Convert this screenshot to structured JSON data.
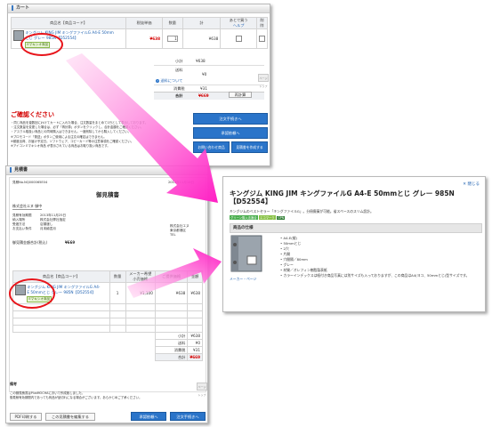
{
  "cart": {
    "title": "カート",
    "headers": {
      "product": "商品名【商品コード】",
      "unit_price": "税抜単価",
      "qty": "数量",
      "total": "計",
      "wish": "あとで買う",
      "delete": "削除"
    },
    "wish_sub": "ヘルプ",
    "item": {
      "name": "キングジム KING JIM キングファイルG A4-E 50mmとじ グレー 985N【D52554】",
      "badge": "Eマキシオ商品",
      "price": "¥638",
      "qty": "1",
      "total": "¥638"
    },
    "subtotal_label": "小計",
    "subtotal": "¥638",
    "shipping_label": "送料",
    "shipping": "¥0",
    "shipping_note": "送料について",
    "tax_label": "消費税",
    "tax": "¥31",
    "grand_label": "合計",
    "grand": "¥669",
    "recalc": "再計算",
    "tab": "ページトップ",
    "confirm_title": "ご確認ください",
    "confirm_lines": [
      "・同じ商品を複数回にわけてカートに入れた場合、注文数量をまとめて1行として表示しております。",
      "・注文数量を変更した場合は、必ず「再計算」ボタンをクリックし、合計金額をご確認ください。",
      "・アスクル取扱い商品との同時購入はできません。一度削除してから購入してください。",
      "※プロモコード「発送」ボタンご使用による注文の確定はできません。",
      "※都度出荷、お届け予定日。ソフトウェア、コピーカード等の注意事項をご確認ください。",
      "※アイコン  Eマキシオ商品 が表示されている商品はお取り扱い商品です。"
    ],
    "checkout_btn": "注文手続きへ",
    "quote_btn": "承認依頼へ",
    "compare_btn": "お問い合わせ商品",
    "print_btn": "見積書を作成する"
  },
  "quote": {
    "title": "見積書",
    "doc_no": "見積No.NQ000065E04",
    "date": "2013年11月18日",
    "heading": "御見積書",
    "company": "株式会社エヌ 御中",
    "info_labels": [
      "見積有効期限",
      "納入場所",
      "受渡方法",
      "お支払い条件"
    ],
    "info_values": [
      "2013年11月25日",
      "株式会社弊社指定",
      "店頭渡し",
      "月末締翌月"
    ],
    "right_company": "株式会社エヌ",
    "right_addr": "東京都港区",
    "right_tel": "TEL",
    "amount_label": "御見積金額合計(税込)",
    "amount": "¥669",
    "headers": {
      "product": "商品名【商品コード】",
      "qty": "数量",
      "list": "メーカー希望小売価格",
      "price": "ご提供価格",
      "amount": "金額"
    },
    "item": {
      "name": "キングジム KING JIM キングファイルG A4-E 50mmとじ グレー 985N【D52554】",
      "badge": "Eマキシオ商品",
      "qty": "1",
      "list": "¥1,100",
      "price": "¥638",
      "amount": "¥638"
    },
    "subtotal_label": "小計",
    "subtotal": "¥638",
    "shipping_label": "送料",
    "shipping": "¥0",
    "tax_label": "消費税",
    "tax": "¥31",
    "grand_label": "合計",
    "grand": "¥669",
    "note_title": "備考",
    "note_lines": [
      "この御見積書はPlusMOCHAにおいて作成致しました。",
      "御見積有効期間内であっても商品が品切れになる場合がございます。あらかじめご了承ください。"
    ],
    "tab": "ページトップ",
    "pdf_btn": "PDF印刷する",
    "edit_btn": "この見積書を編集する",
    "approve_btn": "承認依頼へ",
    "order_btn": "注文手続きへ"
  },
  "detail": {
    "close": "閉じる",
    "title": "キングジム KING JIM キングファイルG A4-E 50mmとじ グレー 985N【D52554】",
    "subtitle": "キングジムのベストセラー「キングファイルG」。分冊廃棄が可能。省スペースのスリム設計。",
    "badges": [
      "グリーン購入法適合",
      "エコマーク",
      "GPN"
    ],
    "spec_title": "商品の仕様",
    "specs": [
      "A4-E(縦)",
      "50mmとじ",
      "2穴",
      "片開",
      "穴間隔／80mm",
      "グレー",
      "材質／オレフィン樹脂製表紙",
      "カラーインデックスは紙付き商品写真には別サイズも入っておりますが、この商品はA4(ヨコ、50mmとじ)型サイズです。"
    ],
    "maker_link": "メーカー・ページ"
  }
}
